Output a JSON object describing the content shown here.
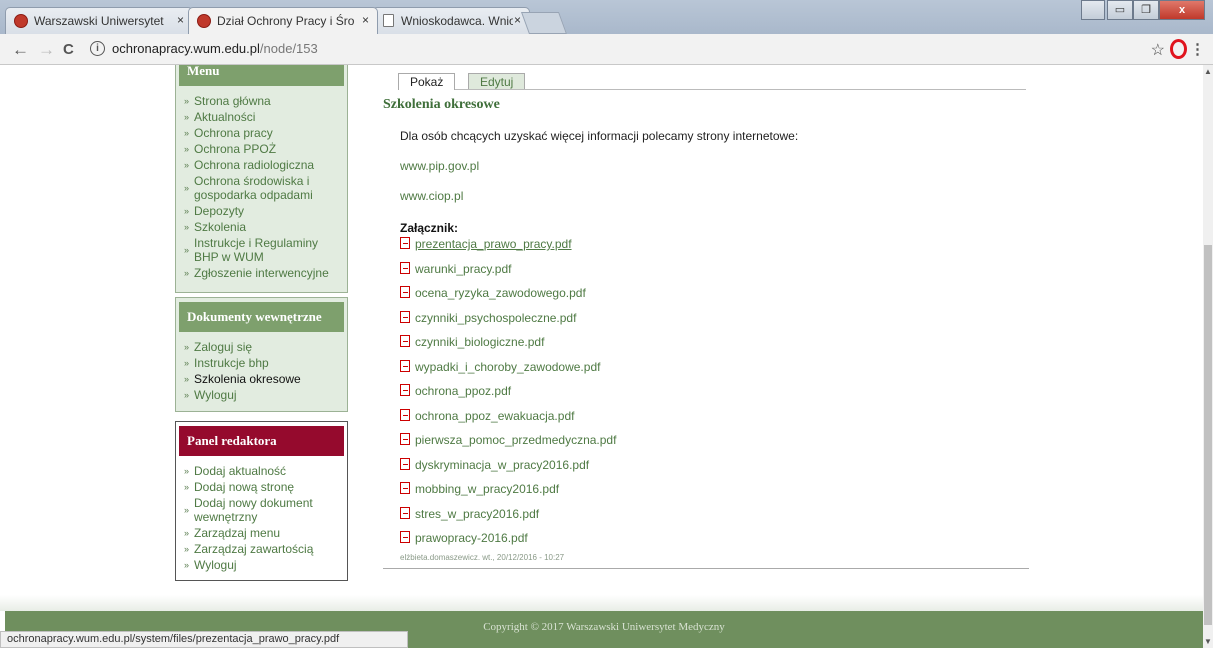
{
  "browser": {
    "tabs": [
      {
        "title": "Warszawski Uniwersytet",
        "close": "×"
      },
      {
        "title": "Dział Ochrony Pracy i Śro",
        "close": "×"
      },
      {
        "title": "Wnioskodawca. Wnioski",
        "close": "×"
      }
    ],
    "url_host": "ochronapracy.wum.edu.pl",
    "url_path": "/node/153",
    "nav": {
      "back": "←",
      "forward": "→",
      "reload": "C"
    },
    "star": "☆",
    "menu": "⋮",
    "window_buttons": {
      "minimize": "▭",
      "maximize": "❐",
      "close": "x"
    }
  },
  "sidebar": {
    "menu": {
      "title": "Menu",
      "items": [
        "Strona główna",
        "Aktualności",
        "Ochrona pracy",
        "Ochrona PPOŻ",
        "Ochrona radiologiczna",
        "Ochrona środowiska i gospodarka odpadami",
        "Depozyty",
        "Szkolenia",
        "Instrukcje i Regulaminy BHP w WUM",
        "Zgłoszenie interwencyjne"
      ]
    },
    "internal": {
      "title": "Dokumenty wewnętrzne",
      "items": [
        "Zaloguj się",
        "Instrukcje bhp",
        "Szkolenia okresowe",
        "Wyloguj"
      ]
    },
    "editor": {
      "title": "Panel redaktora",
      "items": [
        "Dodaj aktualność",
        "Dodaj nową stronę",
        "Dodaj nowy dokument wewnętrzny",
        "Zarządzaj menu",
        "Zarządzaj zawartością",
        "Wyloguj"
      ]
    }
  },
  "content": {
    "tabs": {
      "view": "Pokaż",
      "edit": "Edytuj"
    },
    "title": "Szkolenia okresowe",
    "intro": "Dla osób chcących uzyskać więcej informacji polecamy strony internetowe:",
    "links": [
      "www.pip.gov.pl",
      "www.ciop.pl"
    ],
    "attachment_label": "Załącznik:",
    "files": [
      "prezentacja_prawo_pracy.pdf",
      "warunki_pracy.pdf",
      "ocena_ryzyka_zawodowego.pdf",
      "czynniki_psychospoleczne.pdf",
      "czynniki_biologiczne.pdf",
      "wypadki_i_choroby_zawodowe.pdf",
      "ochrona_ppoz.pdf",
      "ochrona_ppoz_ewakuacja.pdf",
      "pierwsza_pomoc_przedmedyczna.pdf",
      "dyskryminacja_w_pracy2016.pdf",
      "mobbing_w_pracy2016.pdf",
      "stres_w_pracy2016.pdf",
      "prawopracy-2016.pdf"
    ],
    "meta": "elżbieta.domaszewicz. wt., 20/12/2016 - 10:27"
  },
  "footer": {
    "copyright": "Copyright © 2017 Warszawski Uniwersytet Medyczny"
  },
  "status_bar": "ochronapracy.wum.edu.pl/system/files/prezentacja_prawo_pracy.pdf"
}
